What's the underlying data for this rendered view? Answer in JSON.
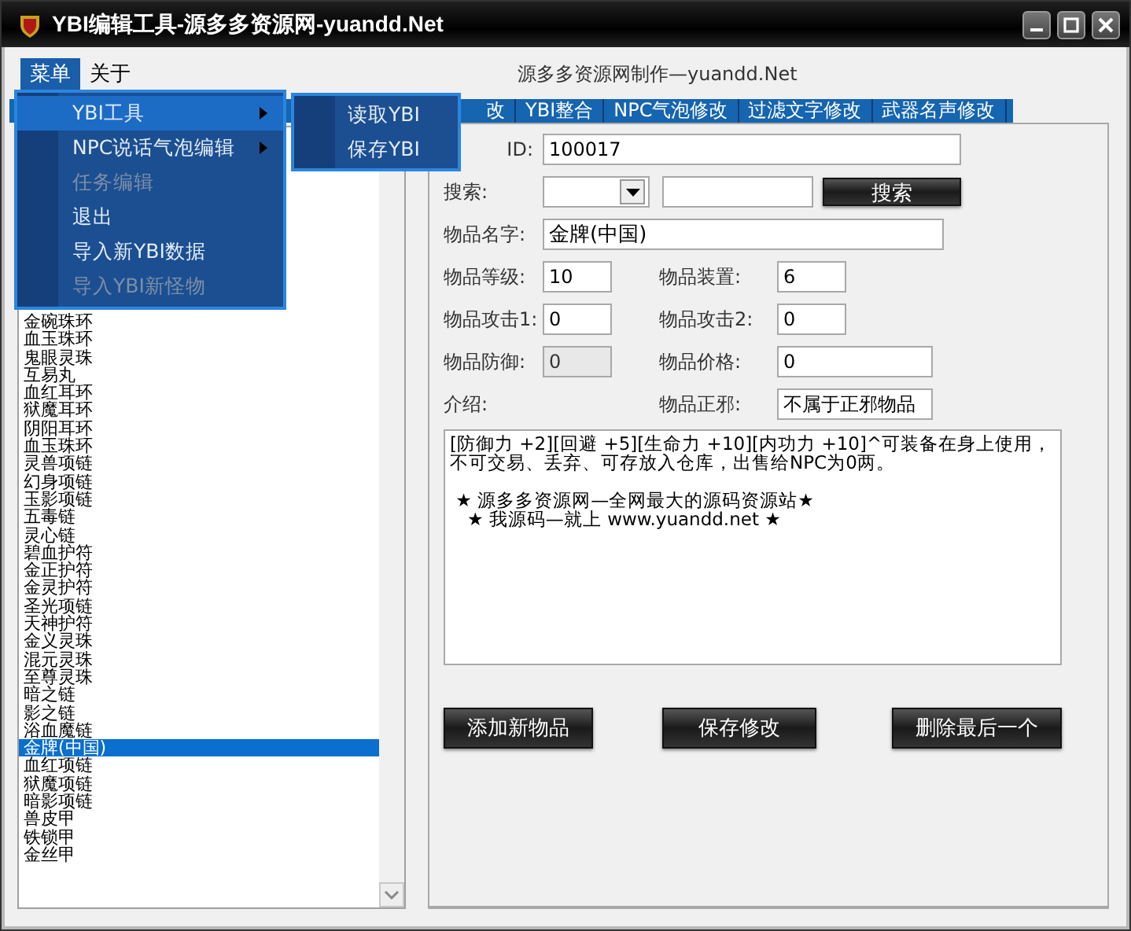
{
  "window": {
    "title": "YBI编辑工具-源多多资源网-yuandd.Net"
  },
  "menubar": [
    {
      "label": "菜单",
      "selected": true
    },
    {
      "label": "关于",
      "selected": false
    }
  ],
  "menu": [
    {
      "label": "YBI工具",
      "selected": true,
      "disabled": false,
      "submenu": true
    },
    {
      "label": "NPC说话气泡编辑",
      "selected": false,
      "disabled": false,
      "submenu": true
    },
    {
      "label": "任务编辑",
      "selected": false,
      "disabled": true,
      "submenu": false
    },
    {
      "label": "退出",
      "selected": false,
      "disabled": false,
      "submenu": false
    },
    {
      "label": "导入新YBI数据",
      "selected": false,
      "disabled": false,
      "submenu": false
    },
    {
      "label": "导入YBI新怪物",
      "selected": false,
      "disabled": true,
      "submenu": false
    }
  ],
  "submenu": [
    "读取YBI",
    "保存YBI"
  ],
  "header": "源多多资源网制作—yuandd.Net",
  "tabs": [
    {
      "label": "改",
      "selected": false
    },
    {
      "label": "YBI整合",
      "selected": false
    },
    {
      "label": "NPC气泡修改",
      "selected": false
    },
    {
      "label": "过滤文字修改",
      "selected": false
    },
    {
      "label": "武器名声修改",
      "selected": false
    }
  ],
  "item_list": [
    {
      "label": "金碗珠环",
      "selected": false
    },
    {
      "label": "血玉珠环",
      "selected": false
    },
    {
      "label": "鬼眼灵珠",
      "selected": false
    },
    {
      "label": "互易丸",
      "selected": false
    },
    {
      "label": "血红耳环",
      "selected": false
    },
    {
      "label": "狱魔耳环",
      "selected": false
    },
    {
      "label": "阴阳耳环",
      "selected": false
    },
    {
      "label": "血玉珠环",
      "selected": false
    },
    {
      "label": "灵兽项链",
      "selected": false
    },
    {
      "label": "幻身项链",
      "selected": false
    },
    {
      "label": "玉影项链",
      "selected": false
    },
    {
      "label": "五毒链",
      "selected": false
    },
    {
      "label": "灵心链",
      "selected": false
    },
    {
      "label": "碧血护符",
      "selected": false
    },
    {
      "label": "金正护符",
      "selected": false
    },
    {
      "label": "金灵护符",
      "selected": false
    },
    {
      "label": "圣光项链",
      "selected": false
    },
    {
      "label": "天神护符",
      "selected": false
    },
    {
      "label": "金义灵珠",
      "selected": false
    },
    {
      "label": "混元灵珠",
      "selected": false
    },
    {
      "label": "至尊灵珠",
      "selected": false
    },
    {
      "label": "暗之链",
      "selected": false
    },
    {
      "label": "影之链",
      "selected": false
    },
    {
      "label": "浴血魔链",
      "selected": false
    },
    {
      "label": "金牌(中国)",
      "selected": true
    },
    {
      "label": "血红项链",
      "selected": false
    },
    {
      "label": "狱魔项链",
      "selected": false
    },
    {
      "label": "暗影项链",
      "selected": false
    },
    {
      "label": "兽皮甲",
      "selected": false
    },
    {
      "label": "铁锁甲",
      "selected": false
    },
    {
      "label": "金丝甲",
      "selected": false
    }
  ],
  "form": {
    "id_label": "ID:",
    "id_value": "100017",
    "search_label": "搜索:",
    "search_button": "搜索",
    "name_label": "物品名字:",
    "name_value": "金牌(中国)",
    "pairs": [
      [
        {
          "label": "物品等级:",
          "value": "10",
          "disabled": false,
          "wide": false
        },
        {
          "label": "物品装置:",
          "value": "6",
          "disabled": false,
          "wide": false
        }
      ],
      [
        {
          "label": "物品攻击1:",
          "value": "0",
          "disabled": false,
          "wide": false
        },
        {
          "label": "物品攻击2:",
          "value": "0",
          "disabled": false,
          "wide": false
        }
      ],
      [
        {
          "label": "物品防御:",
          "value": "0",
          "disabled": true,
          "wide": false
        },
        {
          "label": "物品价格:",
          "value": "0",
          "disabled": false,
          "wide": true
        }
      ],
      [
        {
          "label": "介绍:"
        },
        {
          "label": "物品正邪:",
          "value": "不属于正邪物品",
          "disabled": false,
          "wide": true
        }
      ]
    ],
    "description": [
      "[防御力 +2][回避 +5][生命力 +10][内功力 +10]^可装备在身上使用，不可交易、丢弃、可存放入仓库，出售给NPC为0两。",
      " ★ 源多多资源网—全网最大的源码资源站★",
      "   ★ 我源码—就上 www.yuandd.net ★"
    ]
  },
  "buttons": [
    "添加新物品",
    "保存修改",
    "删除最后一个"
  ]
}
